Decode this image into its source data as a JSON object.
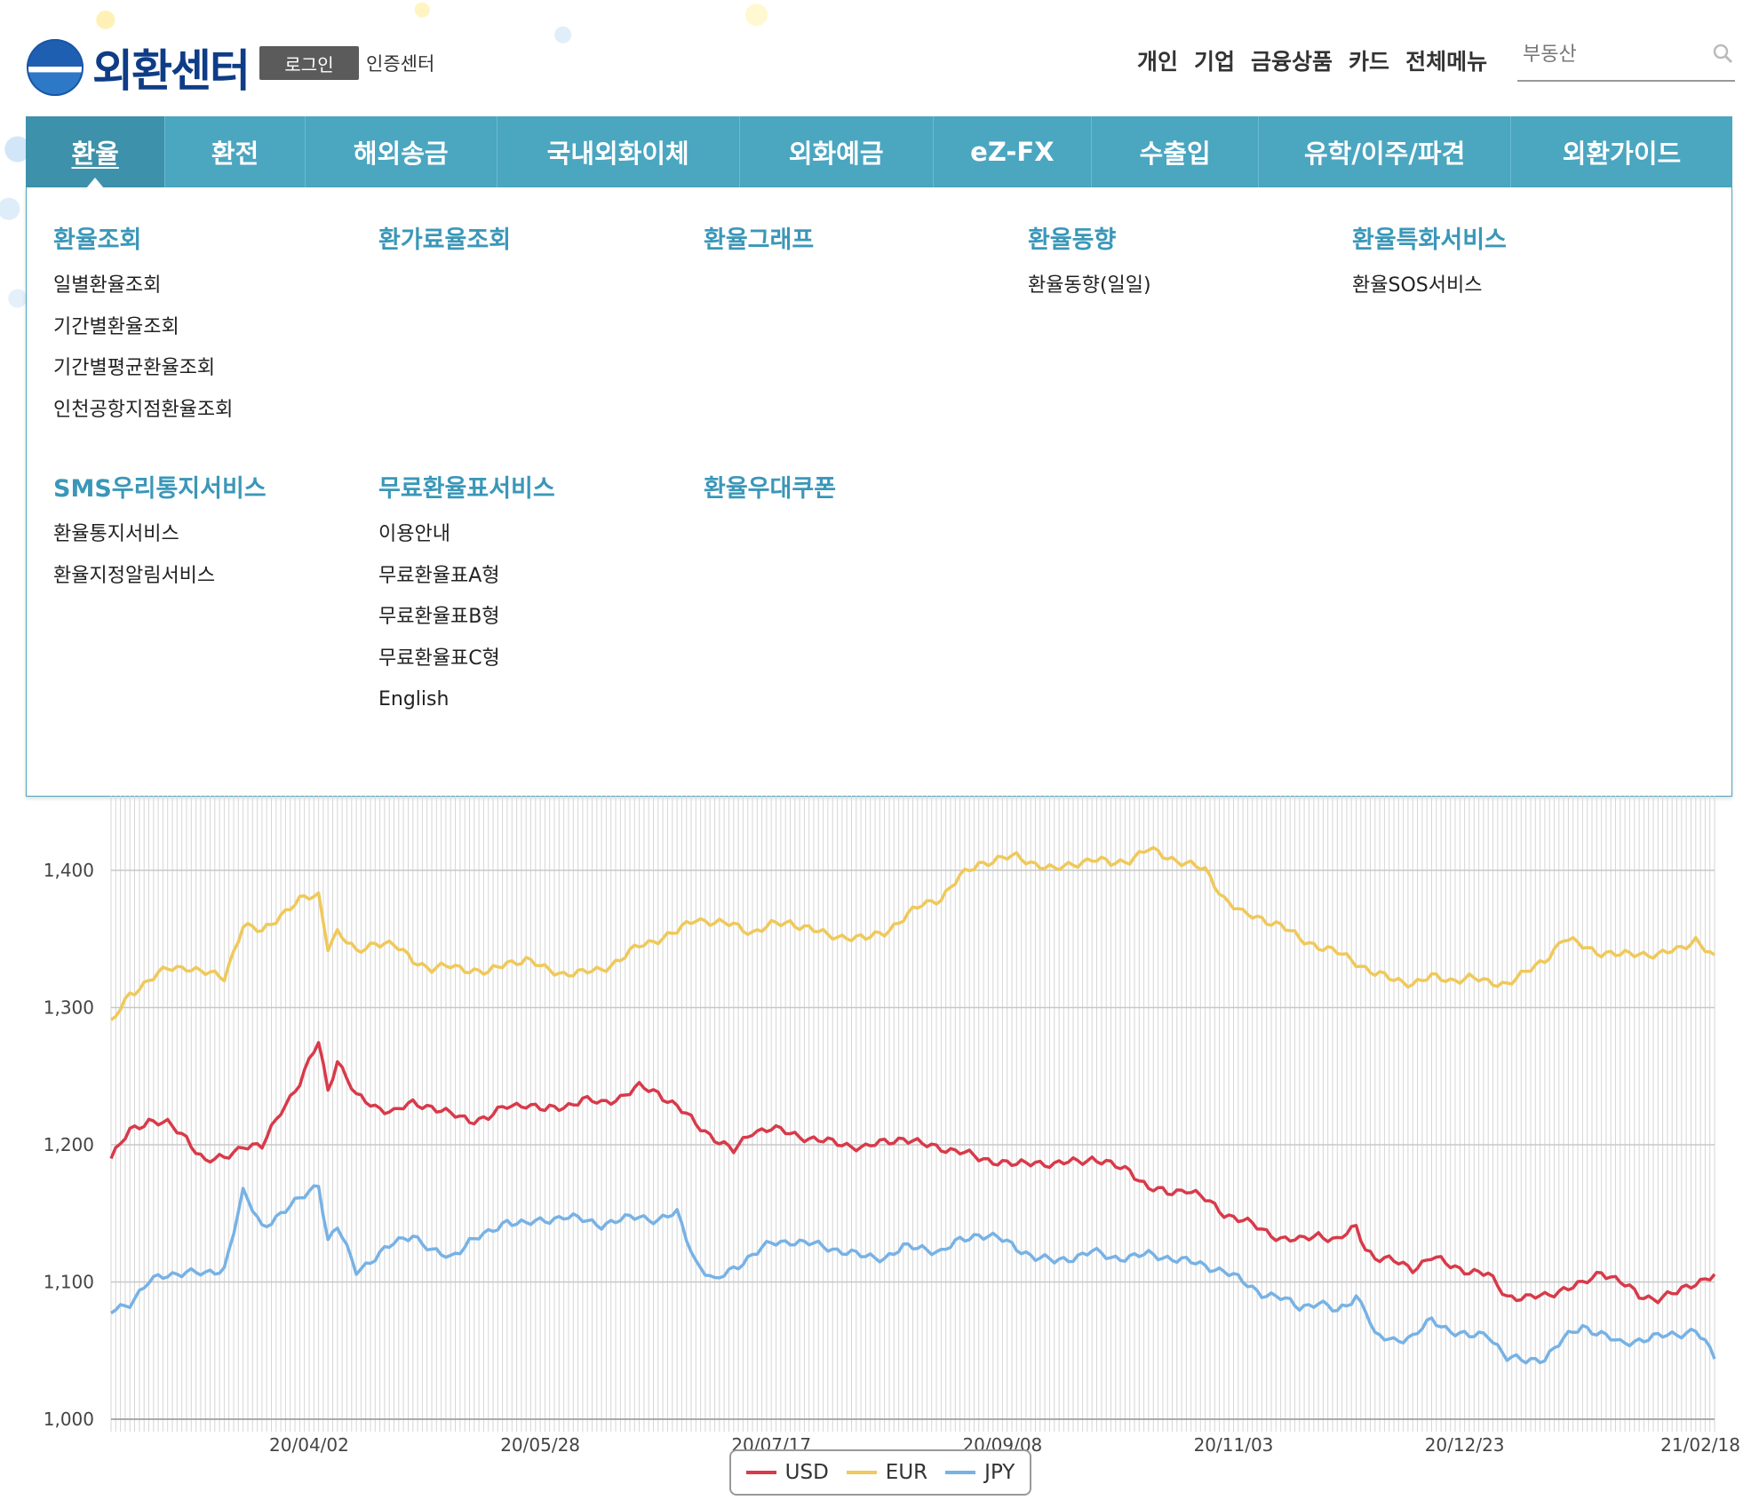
{
  "header": {
    "logo_text": "외환센터",
    "login_label": "로그인",
    "cert_label": "인증센터",
    "top_links": [
      "개인",
      "기업",
      "금융상품",
      "카드",
      "전체메뉴"
    ],
    "search_placeholder": "부동산"
  },
  "main_nav": [
    "환율",
    "환전",
    "해외송금",
    "국내외화이체",
    "외화예금",
    "eZ-FX",
    "수출입",
    "유학/이주/파견",
    "외환가이드"
  ],
  "dropdown": {
    "groups": [
      {
        "title": "환율조회",
        "items": [
          "일별환율조회",
          "기간별환율조회",
          "기간별평균환율조회",
          "인천공항지점환율조회"
        ]
      },
      {
        "title": "환가료율조회",
        "items": []
      },
      {
        "title": "환율그래프",
        "items": []
      },
      {
        "title": "환율동향",
        "items": [
          "환율동향(일일)"
        ]
      },
      {
        "title": "환율특화서비스",
        "items": [
          "환율SOS서비스"
        ]
      },
      {
        "title": "SMS우리통지서비스",
        "items": [
          "환율통지서비스",
          "환율지정알림서비스"
        ]
      },
      {
        "title": "무료환율표서비스",
        "items": [
          "이용안내",
          "무료환율표A형",
          "무료환율표B형",
          "무료환율표C형",
          "English"
        ]
      },
      {
        "title": "환율우대쿠폰",
        "items": []
      }
    ]
  },
  "chart_data": {
    "type": "line",
    "ylim": [
      1000,
      1400
    ],
    "y_ticks": [
      "1,000",
      "1,100",
      "1,200",
      "1,300",
      "1,400"
    ],
    "x_tick_labels": [
      "20/04/02",
      "20/05/28",
      "20/07/17",
      "20/09/08",
      "20/11/03",
      "20/12/23",
      "21/02/18"
    ],
    "x_tick_index": [
      42,
      91,
      140,
      189,
      238,
      287,
      337
    ],
    "n_points": 340,
    "legend_position": "bottom-center",
    "series": [
      {
        "name": "USD",
        "color": "#d83a4a",
        "anchors": [
          [
            0,
            1190
          ],
          [
            4,
            1210
          ],
          [
            8,
            1218
          ],
          [
            12,
            1215
          ],
          [
            16,
            1205
          ],
          [
            20,
            1188
          ],
          [
            24,
            1190
          ],
          [
            28,
            1200
          ],
          [
            32,
            1198
          ],
          [
            36,
            1225
          ],
          [
            40,
            1245
          ],
          [
            44,
            1275
          ],
          [
            46,
            1240
          ],
          [
            48,
            1262
          ],
          [
            52,
            1235
          ],
          [
            56,
            1228
          ],
          [
            60,
            1224
          ],
          [
            64,
            1230
          ],
          [
            68,
            1228
          ],
          [
            72,
            1222
          ],
          [
            76,
            1218
          ],
          [
            80,
            1220
          ],
          [
            84,
            1228
          ],
          [
            88,
            1230
          ],
          [
            92,
            1225
          ],
          [
            96,
            1228
          ],
          [
            100,
            1233
          ],
          [
            104,
            1230
          ],
          [
            108,
            1235
          ],
          [
            112,
            1242
          ],
          [
            116,
            1238
          ],
          [
            120,
            1228
          ],
          [
            124,
            1215
          ],
          [
            128,
            1205
          ],
          [
            132,
            1195
          ],
          [
            136,
            1210
          ],
          [
            140,
            1212
          ],
          [
            144,
            1208
          ],
          [
            148,
            1205
          ],
          [
            152,
            1202
          ],
          [
            156,
            1200
          ],
          [
            160,
            1198
          ],
          [
            164,
            1202
          ],
          [
            168,
            1205
          ],
          [
            172,
            1200
          ],
          [
            176,
            1198
          ],
          [
            180,
            1195
          ],
          [
            184,
            1190
          ],
          [
            188,
            1188
          ],
          [
            192,
            1185
          ],
          [
            196,
            1188
          ],
          [
            200,
            1185
          ],
          [
            204,
            1188
          ],
          [
            208,
            1190
          ],
          [
            212,
            1185
          ],
          [
            216,
            1182
          ],
          [
            220,
            1168
          ],
          [
            224,
            1165
          ],
          [
            228,
            1168
          ],
          [
            232,
            1160
          ],
          [
            236,
            1150
          ],
          [
            240,
            1145
          ],
          [
            244,
            1138
          ],
          [
            248,
            1132
          ],
          [
            252,
            1130
          ],
          [
            256,
            1135
          ],
          [
            260,
            1130
          ],
          [
            264,
            1140
          ],
          [
            266,
            1125
          ],
          [
            268,
            1118
          ],
          [
            272,
            1115
          ],
          [
            276,
            1110
          ],
          [
            280,
            1118
          ],
          [
            284,
            1112
          ],
          [
            288,
            1108
          ],
          [
            292,
            1105
          ],
          [
            296,
            1090
          ],
          [
            300,
            1088
          ],
          [
            304,
            1090
          ],
          [
            308,
            1095
          ],
          [
            312,
            1098
          ],
          [
            316,
            1108
          ],
          [
            320,
            1100
          ],
          [
            324,
            1090
          ],
          [
            328,
            1088
          ],
          [
            332,
            1092
          ],
          [
            336,
            1100
          ],
          [
            340,
            1105
          ]
        ]
      },
      {
        "name": "EUR",
        "color": "#efc95a",
        "anchors": [
          [
            0,
            1288
          ],
          [
            4,
            1310
          ],
          [
            8,
            1320
          ],
          [
            12,
            1328
          ],
          [
            16,
            1330
          ],
          [
            20,
            1325
          ],
          [
            24,
            1322
          ],
          [
            28,
            1360
          ],
          [
            32,
            1355
          ],
          [
            36,
            1368
          ],
          [
            40,
            1378
          ],
          [
            44,
            1382
          ],
          [
            46,
            1345
          ],
          [
            48,
            1355
          ],
          [
            52,
            1340
          ],
          [
            56,
            1348
          ],
          [
            60,
            1345
          ],
          [
            64,
            1335
          ],
          [
            68,
            1328
          ],
          [
            72,
            1330
          ],
          [
            76,
            1328
          ],
          [
            80,
            1325
          ],
          [
            84,
            1333
          ],
          [
            88,
            1335
          ],
          [
            92,
            1328
          ],
          [
            96,
            1325
          ],
          [
            100,
            1325
          ],
          [
            104,
            1328
          ],
          [
            108,
            1335
          ],
          [
            112,
            1345
          ],
          [
            116,
            1350
          ],
          [
            120,
            1355
          ],
          [
            124,
            1365
          ],
          [
            128,
            1362
          ],
          [
            132,
            1360
          ],
          [
            136,
            1355
          ],
          [
            140,
            1360
          ],
          [
            144,
            1362
          ],
          [
            148,
            1358
          ],
          [
            152,
            1352
          ],
          [
            156,
            1352
          ],
          [
            160,
            1350
          ],
          [
            164,
            1355
          ],
          [
            168,
            1365
          ],
          [
            172,
            1375
          ],
          [
            176,
            1380
          ],
          [
            180,
            1395
          ],
          [
            184,
            1405
          ],
          [
            188,
            1408
          ],
          [
            192,
            1410
          ],
          [
            196,
            1405
          ],
          [
            200,
            1400
          ],
          [
            204,
            1405
          ],
          [
            208,
            1408
          ],
          [
            212,
            1405
          ],
          [
            216,
            1408
          ],
          [
            220,
            1415
          ],
          [
            224,
            1410
          ],
          [
            228,
            1405
          ],
          [
            232,
            1400
          ],
          [
            236,
            1380
          ],
          [
            240,
            1368
          ],
          [
            244,
            1365
          ],
          [
            248,
            1360
          ],
          [
            252,
            1350
          ],
          [
            256,
            1345
          ],
          [
            260,
            1340
          ],
          [
            264,
            1333
          ],
          [
            268,
            1325
          ],
          [
            272,
            1320
          ],
          [
            276,
            1318
          ],
          [
            280,
            1322
          ],
          [
            284,
            1320
          ],
          [
            288,
            1322
          ],
          [
            292,
            1318
          ],
          [
            296,
            1318
          ],
          [
            300,
            1325
          ],
          [
            304,
            1335
          ],
          [
            308,
            1350
          ],
          [
            312,
            1345
          ],
          [
            316,
            1340
          ],
          [
            320,
            1338
          ],
          [
            324,
            1340
          ],
          [
            328,
            1338
          ],
          [
            332,
            1342
          ],
          [
            336,
            1350
          ],
          [
            340,
            1335
          ]
        ]
      },
      {
        "name": "JPY",
        "color": "#77b2e5",
        "anchors": [
          [
            0,
            1078
          ],
          [
            4,
            1085
          ],
          [
            8,
            1100
          ],
          [
            12,
            1105
          ],
          [
            16,
            1108
          ],
          [
            20,
            1105
          ],
          [
            24,
            1110
          ],
          [
            28,
            1165
          ],
          [
            32,
            1140
          ],
          [
            36,
            1150
          ],
          [
            40,
            1160
          ],
          [
            44,
            1172
          ],
          [
            46,
            1130
          ],
          [
            48,
            1140
          ],
          [
            52,
            1108
          ],
          [
            56,
            1118
          ],
          [
            60,
            1128
          ],
          [
            64,
            1135
          ],
          [
            68,
            1122
          ],
          [
            72,
            1118
          ],
          [
            76,
            1130
          ],
          [
            80,
            1135
          ],
          [
            84,
            1145
          ],
          [
            88,
            1142
          ],
          [
            92,
            1145
          ],
          [
            96,
            1148
          ],
          [
            100,
            1145
          ],
          [
            104,
            1142
          ],
          [
            108,
            1145
          ],
          [
            112,
            1148
          ],
          [
            116,
            1145
          ],
          [
            120,
            1150
          ],
          [
            124,
            1115
          ],
          [
            128,
            1100
          ],
          [
            132,
            1110
          ],
          [
            136,
            1120
          ],
          [
            140,
            1128
          ],
          [
            144,
            1130
          ],
          [
            148,
            1128
          ],
          [
            152,
            1125
          ],
          [
            156,
            1122
          ],
          [
            160,
            1118
          ],
          [
            164,
            1118
          ],
          [
            168,
            1125
          ],
          [
            172,
            1125
          ],
          [
            176,
            1122
          ],
          [
            180,
            1130
          ],
          [
            184,
            1135
          ],
          [
            188,
            1132
          ],
          [
            192,
            1125
          ],
          [
            196,
            1118
          ],
          [
            200,
            1115
          ],
          [
            204,
            1118
          ],
          [
            208,
            1122
          ],
          [
            212,
            1118
          ],
          [
            216,
            1118
          ],
          [
            220,
            1120
          ],
          [
            224,
            1118
          ],
          [
            228,
            1115
          ],
          [
            232,
            1112
          ],
          [
            236,
            1108
          ],
          [
            240,
            1100
          ],
          [
            244,
            1092
          ],
          [
            248,
            1088
          ],
          [
            252,
            1082
          ],
          [
            256,
            1085
          ],
          [
            260,
            1078
          ],
          [
            264,
            1090
          ],
          [
            266,
            1080
          ],
          [
            268,
            1060
          ],
          [
            272,
            1058
          ],
          [
            276,
            1060
          ],
          [
            280,
            1072
          ],
          [
            284,
            1065
          ],
          [
            288,
            1060
          ],
          [
            292,
            1062
          ],
          [
            296,
            1045
          ],
          [
            300,
            1042
          ],
          [
            304,
            1045
          ],
          [
            308,
            1058
          ],
          [
            312,
            1068
          ],
          [
            316,
            1062
          ],
          [
            320,
            1055
          ],
          [
            324,
            1058
          ],
          [
            328,
            1060
          ],
          [
            332,
            1062
          ],
          [
            336,
            1065
          ],
          [
            340,
            1045
          ]
        ]
      }
    ]
  }
}
